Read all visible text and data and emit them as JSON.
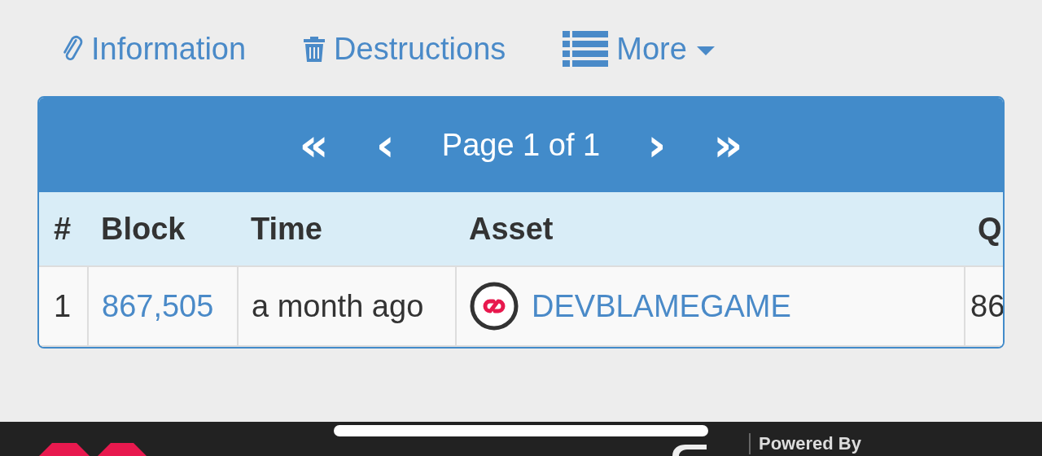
{
  "nav": [
    {
      "kind": "paperclip",
      "label": "Information"
    },
    {
      "kind": "trash",
      "label": "Destructions"
    },
    {
      "kind": "list",
      "label": "More",
      "dropdown": true
    }
  ],
  "pager": {
    "first": "«",
    "prev": "‹",
    "label": "Page 1 of 1",
    "next": "›",
    "last": "»"
  },
  "table": {
    "columns": [
      "#",
      "Block",
      "Time",
      "Asset",
      "Q"
    ],
    "rows": [
      {
        "cells": [
          "1",
          "867,505",
          "a month ago",
          "DEVBLAMEGAME",
          "86"
        ]
      }
    ]
  },
  "footer": {
    "text": "Powered By"
  }
}
